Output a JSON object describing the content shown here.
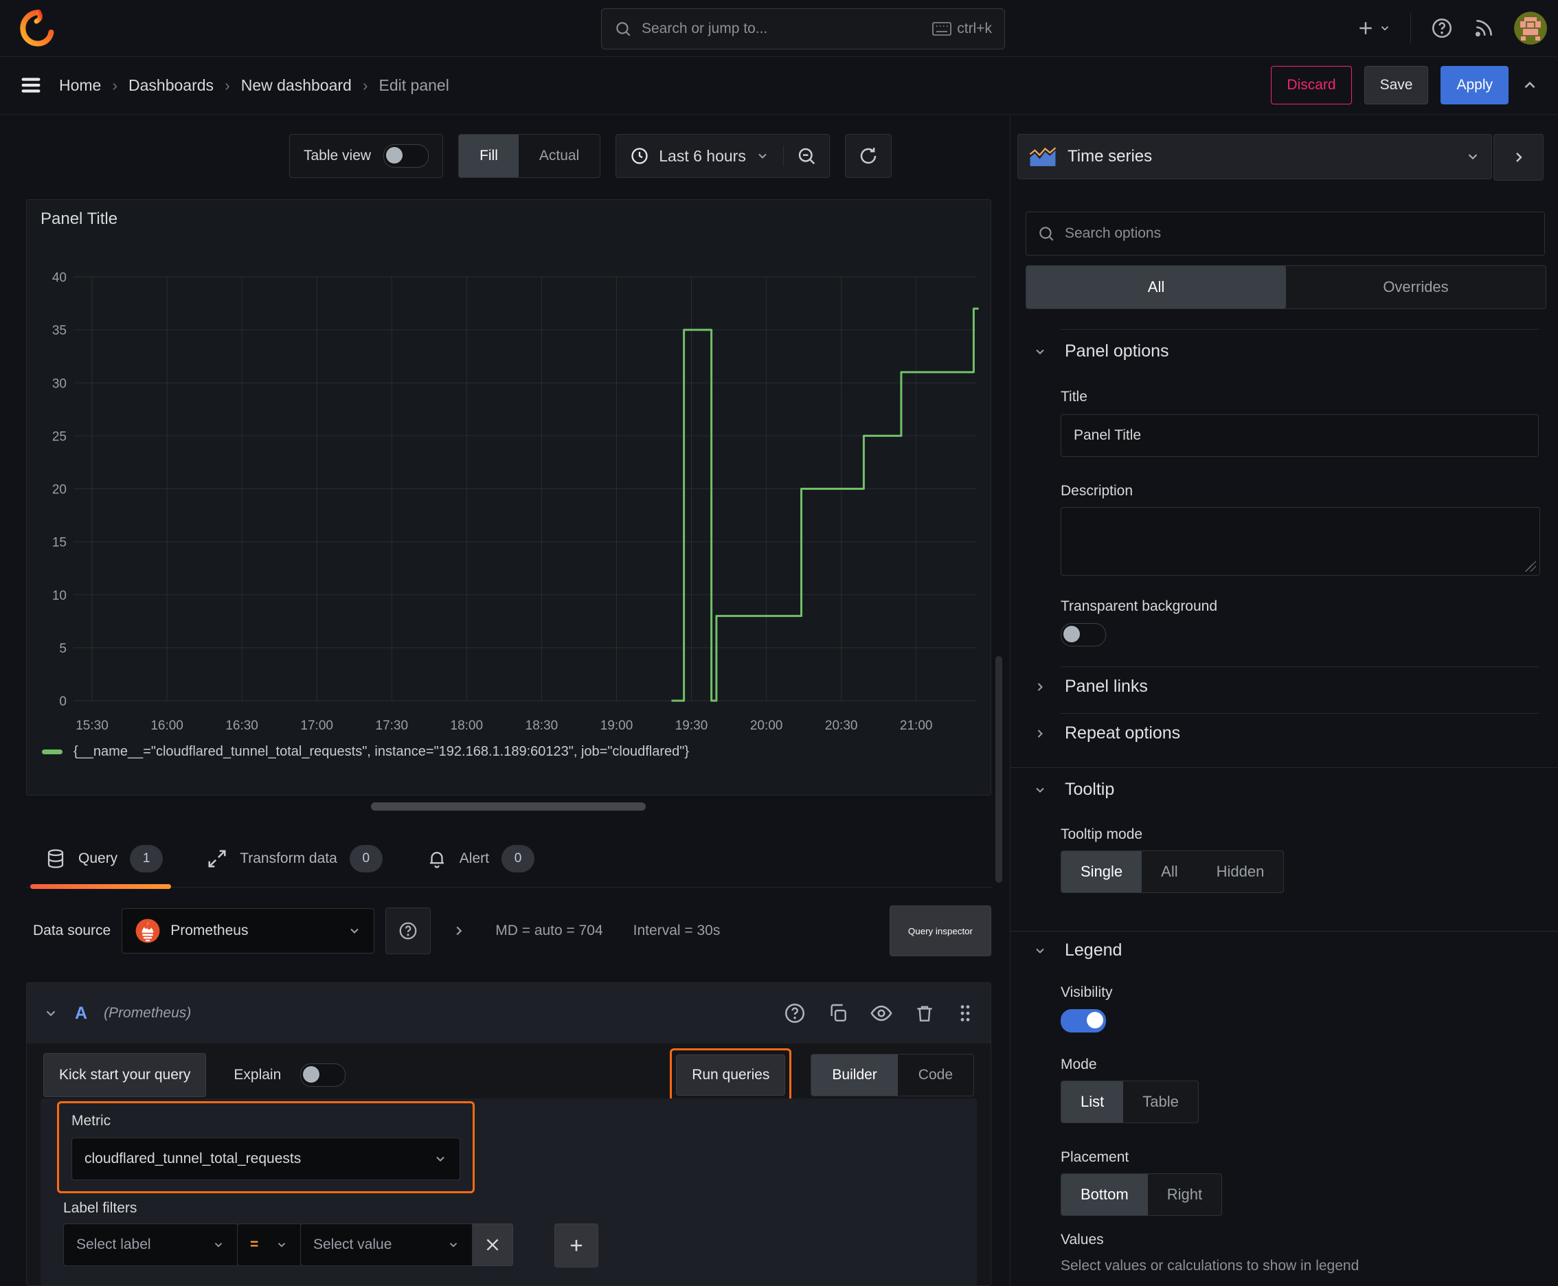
{
  "topbar": {
    "search_placeholder": "Search or jump to...",
    "shortcut": "ctrl+k"
  },
  "breadcrumb": {
    "items": [
      {
        "label": "Home"
      },
      {
        "label": "Dashboards"
      },
      {
        "label": "New dashboard"
      },
      {
        "label": "Edit panel"
      }
    ]
  },
  "header_actions": {
    "discard": "Discard",
    "save": "Save",
    "apply": "Apply"
  },
  "toolbar": {
    "table_view_label": "Table view",
    "view_modes": [
      "Fill",
      "Actual"
    ],
    "selected_view": "Fill",
    "time_range": "Last 6 hours"
  },
  "panel": {
    "title": "Panel Title"
  },
  "chart_data": {
    "type": "line",
    "title": "Panel Title",
    "line_interpolation": "step",
    "xlabel": "",
    "ylabel": "",
    "ylim": [
      0,
      40
    ],
    "x_range_minutes": [
      0,
      354
    ],
    "grid": true,
    "legend_position": "bottom",
    "x_ticks": [
      "15:30",
      "16:00",
      "16:30",
      "17:00",
      "17:30",
      "18:00",
      "18:30",
      "19:00",
      "19:30",
      "20:00",
      "20:30",
      "21:00"
    ],
    "y_ticks": [
      0,
      5,
      10,
      15,
      20,
      25,
      30,
      35,
      40
    ],
    "series": [
      {
        "name": "{__name__=\"cloudflared_tunnel_total_requests\", instance=\"192.168.1.189:60123\", job=\"cloudflared\"}",
        "color": "#73bf69",
        "points_minutes_from_1530": [
          [
            232,
            0
          ],
          [
            237,
            0
          ],
          [
            237,
            35
          ],
          [
            248,
            35
          ],
          [
            248,
            0
          ],
          [
            250,
            0
          ],
          [
            250,
            8
          ],
          [
            284,
            8
          ],
          [
            284,
            20
          ],
          [
            309,
            20
          ],
          [
            309,
            25
          ],
          [
            324,
            25
          ],
          [
            324,
            31
          ],
          [
            353,
            31
          ],
          [
            353,
            37
          ],
          [
            355,
            37
          ]
        ]
      }
    ]
  },
  "series_legend": {
    "color": "#73bf69",
    "label": "{__name__=\"cloudflared_tunnel_total_requests\", instance=\"192.168.1.189:60123\", job=\"cloudflared\"}"
  },
  "query": {
    "tabs": [
      {
        "label": "Query",
        "badge": "1"
      },
      {
        "label": "Transform data",
        "badge": "0"
      },
      {
        "label": "Alert",
        "badge": "0"
      }
    ],
    "datasource": {
      "label": "Data source",
      "value": "Prometheus",
      "md_stat": "MD = auto = 704",
      "interval_stat": "Interval = 30s",
      "inspector_label": "Query inspector"
    },
    "row": {
      "ref_id": "A",
      "datasource_hint": "(Prometheus)"
    },
    "toolbar": {
      "kick_start": "Kick start your query",
      "explain": "Explain",
      "run": "Run queries",
      "editor_modes": [
        "Builder",
        "Code"
      ],
      "selected_editor": "Builder"
    },
    "builder": {
      "metric_label": "Metric",
      "metric_value": "cloudflared_tunnel_total_requests",
      "label_filters": "Label filters",
      "select_label_placeholder": "Select label",
      "operator": "=",
      "select_value_placeholder": "Select value"
    }
  },
  "options_pane": {
    "viz_type": "Time series",
    "search_placeholder": "Search options",
    "tabs": [
      "All",
      "Overrides"
    ],
    "selected_tab": "All",
    "panel_options": {
      "header": "Panel options",
      "title_label": "Title",
      "title_value": "Panel Title",
      "description_label": "Description",
      "description_value": "",
      "transparent_label": "Transparent background",
      "transparent_on": false
    },
    "panel_links": {
      "header": "Panel links"
    },
    "repeat_options": {
      "header": "Repeat options"
    },
    "tooltip": {
      "header": "Tooltip",
      "mode_label": "Tooltip mode",
      "modes": [
        "Single",
        "All",
        "Hidden"
      ],
      "selected_mode": "Single"
    },
    "legend": {
      "header": "Legend",
      "visibility_label": "Visibility",
      "visibility_on": true,
      "mode_label": "Mode",
      "modes": [
        "List",
        "Table"
      ],
      "selected_mode": "List",
      "placement_label": "Placement",
      "placements": [
        "Bottom",
        "Right"
      ],
      "selected_placement": "Bottom",
      "values_label": "Values",
      "values_hint": "Select values or calculations to show in legend"
    }
  },
  "icons": {
    "search": "magnifier",
    "keyboard": "keyboard",
    "add": "plus",
    "help": "question-circle",
    "news": "rss",
    "menu": "hamburger",
    "clock": "clock",
    "zoom_out": "magnifier-minus",
    "refresh": "circular-arrow",
    "query_tab": "database-cylinder",
    "transform_tab": "diagonal-arrows",
    "alert_tab": "bell",
    "duplicate": "copy",
    "hide": "eye",
    "remove": "trash",
    "drag": "grip-dots"
  },
  "colors": {
    "accent_orange": "#ff6a13",
    "apply_blue": "#3d71d9",
    "discard_pink": "#f0266f",
    "series_green": "#73bf69",
    "tab_underline_start": "#f55f3e",
    "tab_underline_end": "#ff9830",
    "prometheus_orange": "#e6522c"
  }
}
